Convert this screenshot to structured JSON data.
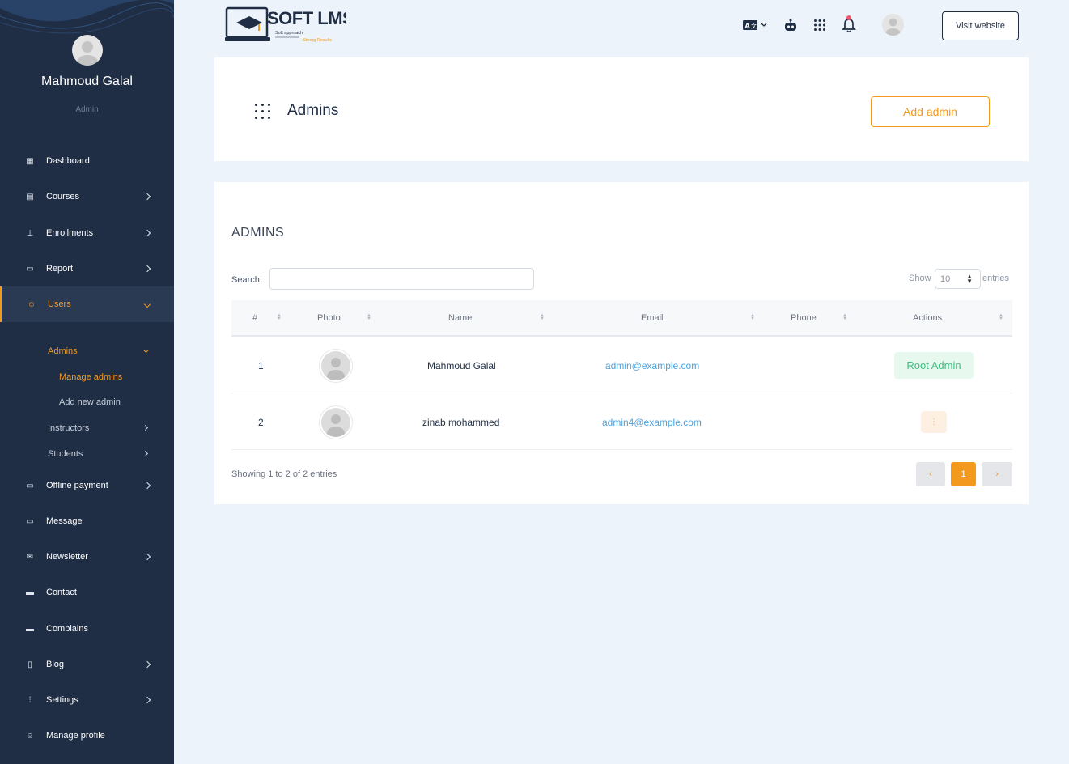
{
  "sidebar": {
    "user_name": "Mahmoud Galal",
    "user_role": "Admin",
    "items": [
      {
        "label": "Dashboard",
        "icon": "grid-icon"
      },
      {
        "label": "Courses",
        "icon": "courses-icon"
      },
      {
        "label": "Enrollments",
        "icon": "enrollments-icon"
      },
      {
        "label": "Report",
        "icon": "report-icon"
      },
      {
        "label": "Users",
        "icon": "users-icon"
      },
      {
        "label": "Offline payment",
        "icon": "payment-icon"
      },
      {
        "label": "Message",
        "icon": "message-icon"
      },
      {
        "label": "Newsletter",
        "icon": "newsletter-icon"
      },
      {
        "label": "Contact",
        "icon": "contact-icon"
      },
      {
        "label": "Complains",
        "icon": "complains-icon"
      },
      {
        "label": "Blog",
        "icon": "blog-icon"
      },
      {
        "label": "Settings",
        "icon": "settings-icon"
      },
      {
        "label": "Manage profile",
        "icon": "profile-icon"
      }
    ],
    "users_sub": {
      "admins": "Admins",
      "manage_admins": "Manage admins",
      "add_new_admin": "Add new admin",
      "instructors": "Instructors",
      "students": "Students"
    }
  },
  "header": {
    "logo_text": "SOFT LMS",
    "logo_tagline": "Soft approach",
    "logo_tagline2": "Strong Results",
    "visit_label": "Visit website",
    "colors": {
      "accent": "#f39a1e",
      "sidebar": "#1f2e45",
      "success": "#3fbf7f",
      "link": "#4aa3df"
    }
  },
  "page": {
    "title": "Admins",
    "add_label": "Add admin"
  },
  "table": {
    "section_title": "ADMINS",
    "search_label": "Search:",
    "search_value": "",
    "show_label": "Show",
    "show_value": "10",
    "entries_label": "entries",
    "columns": [
      "#",
      "Photo",
      "Name",
      "Email",
      "Phone",
      "Actions"
    ],
    "rows": [
      {
        "num": "1",
        "name": "Mahmoud Galal",
        "email": "admin@example.com",
        "phone": "",
        "action": "Root Admin"
      },
      {
        "num": "2",
        "name": "zinab mohammed",
        "email": "admin4@example.com",
        "phone": "",
        "action": "⋮"
      }
    ],
    "info": "Showing 1 to 2 of 2 entries",
    "pagination": {
      "prev": "‹",
      "page": "1",
      "next": "›"
    }
  }
}
